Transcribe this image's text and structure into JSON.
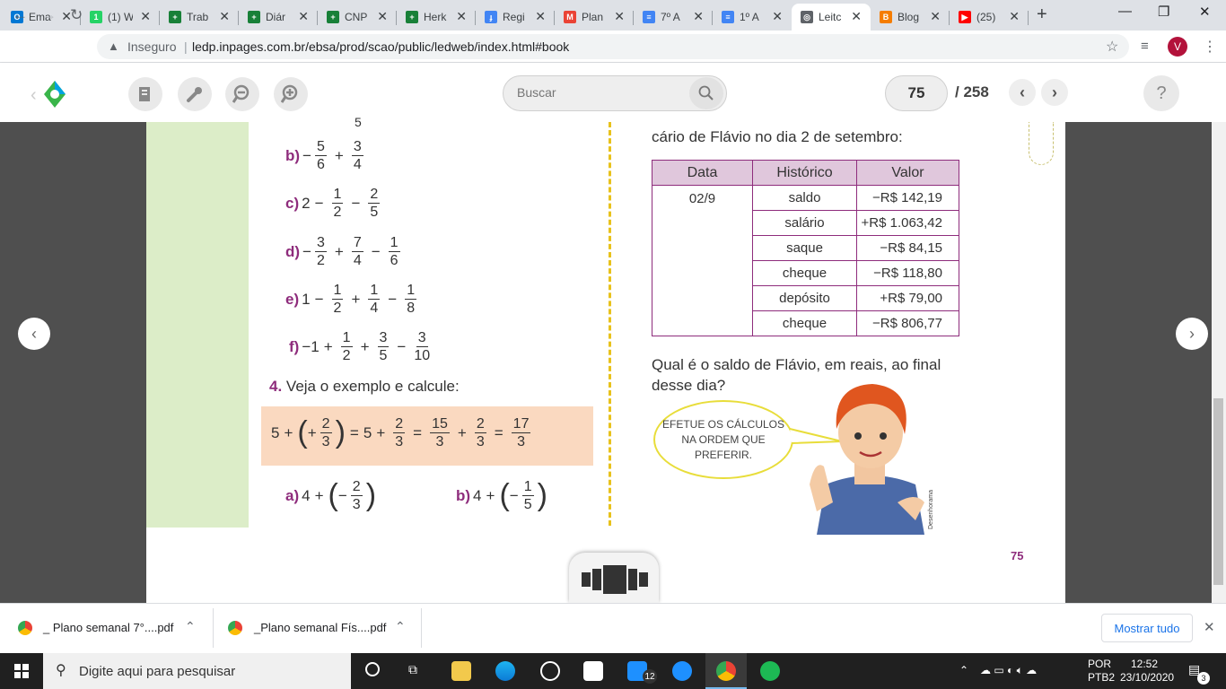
{
  "browser": {
    "tabs": [
      {
        "title": "Ema",
        "color": "#0078d4",
        "letter": "O"
      },
      {
        "title": "(1) W",
        "color": "#25d366",
        "letter": "1"
      },
      {
        "title": "Trab",
        "color": "#188038",
        "letter": "+"
      },
      {
        "title": "Diár",
        "color": "#188038",
        "letter": "+"
      },
      {
        "title": "CNP",
        "color": "#188038",
        "letter": "+"
      },
      {
        "title": "Herk",
        "color": "#188038",
        "letter": "+"
      },
      {
        "title": "Regi",
        "color": "#4285f4",
        "letter": "ɟ"
      },
      {
        "title": "Plan",
        "color": "#ea4335",
        "letter": "M"
      },
      {
        "title": "7º A",
        "color": "#4285f4",
        "letter": "≡"
      },
      {
        "title": "1º A",
        "color": "#4285f4",
        "letter": "≡"
      },
      {
        "title": "Leitc",
        "color": "#5f6368",
        "letter": "◎"
      },
      {
        "title": "Blog",
        "color": "#f57d00",
        "letter": "B"
      },
      {
        "title": "(25)",
        "color": "#ff0000",
        "letter": "▶"
      }
    ],
    "security_label": "Inseguro",
    "url": "ledp.inpages.com.br/ebsa/prod/scao/public/ledweb/index.html#book",
    "profile_initial": "V"
  },
  "reader": {
    "search_placeholder": "Buscar",
    "current_page": "75",
    "total_pages": "/ 258",
    "help": "?"
  },
  "book": {
    "exercises": {
      "b": "b)",
      "c": "c)",
      "d": "d)",
      "e": "e)",
      "f": "f)",
      "q4_number": "4.",
      "q4_text": "Veja o exemplo e calcule:",
      "a2": "a)",
      "b2": "b)"
    },
    "header_line": "cário de Flávio no dia 2 de setembro:",
    "table": {
      "headers": [
        "Data",
        "Histórico",
        "Valor"
      ],
      "date": "02/9",
      "rows": [
        {
          "hist": "saldo",
          "val": "−R$ 142,19"
        },
        {
          "hist": "salário",
          "val": "+R$ 1.063,42"
        },
        {
          "hist": "saque",
          "val": "−R$ 84,15"
        },
        {
          "hist": "cheque",
          "val": "−R$ 118,80"
        },
        {
          "hist": "depósito",
          "val": "+R$ 79,00"
        },
        {
          "hist": "cheque",
          "val": "−R$ 806,77"
        }
      ]
    },
    "question": "Qual é o saldo de Flávio, em reais, ao final desse dia?",
    "bubble": "EFETUE OS CÁLCULOS NA ORDEM QUE PREFERIR.",
    "credit": "Desenhorama",
    "page_label": "75"
  },
  "downloads": {
    "items": [
      "_ Plano semanal 7°....pdf",
      "_Plano semanal Fís....pdf"
    ],
    "show_all": "Mostrar tudo"
  },
  "taskbar": {
    "search_placeholder": "Digite aqui para pesquisar",
    "lang_1": "POR",
    "lang_2": "PTB2",
    "time": "12:52",
    "date": "23/10/2020",
    "mail_badge": "12",
    "notif_badge": "3"
  }
}
